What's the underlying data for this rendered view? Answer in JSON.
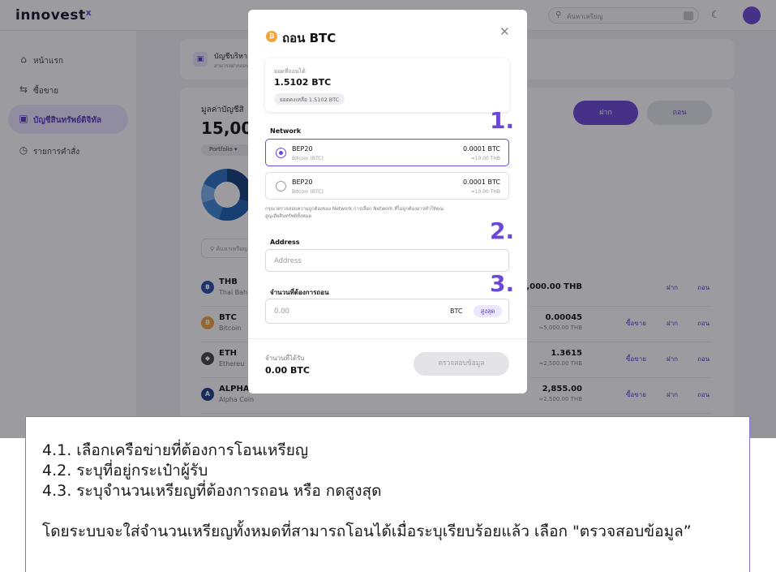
{
  "app": {
    "logo_text": "innovest",
    "logo_mark": "x",
    "search_placeholder": "ค้นหาเหรียญ",
    "icons": {
      "search": "search-icon",
      "theme": "moon-icon",
      "avatar": "avatar-icon"
    }
  },
  "sidebar": {
    "items": [
      {
        "label": "หน้าแรก",
        "icon": "home-icon",
        "symbol": "⌂"
      },
      {
        "label": "ซื้อขาย",
        "icon": "swap-icon",
        "symbol": "⇆"
      },
      {
        "label": "บัญชีสินทรัพย์ดิจิทัล",
        "icon": "wallet-icon",
        "symbol": "▣"
      },
      {
        "label": "รายการคำสั่ง",
        "icon": "clock-icon",
        "symbol": "◷"
      }
    ]
  },
  "account": {
    "title": "บัญชีบริหา",
    "subtitle": "สามารถฝากถอน"
  },
  "portfolio": {
    "value_label": "มูลค่าบัญชีสิ",
    "value": "15,00",
    "pill_label": "Portfolio",
    "search_placeholder": "ค้นหาเหรียญ",
    "deposit_label": "ฝาก",
    "withdraw_label": "ถอน"
  },
  "assets": [
    {
      "symbol": "THB",
      "name": "Thai Bah",
      "amount": "5,000.00 THB",
      "sub": "",
      "trade": "",
      "deposit": "ฝาก",
      "withdraw": "ถอน",
      "color": "#2c4aa3",
      "glyph": "฿"
    },
    {
      "symbol": "BTC",
      "name": "Bitcoin",
      "amount": "0.00045",
      "sub": "≈5,000.00 THB",
      "trade": "ซื้อขาย",
      "deposit": "ฝาก",
      "withdraw": "ถอน",
      "color": "#f2a33a",
      "glyph": "B"
    },
    {
      "symbol": "ETH",
      "name": "Ethereu",
      "amount": "1.3615",
      "sub": "≈2,500.00 THB",
      "trade": "ซื้อขาย",
      "deposit": "ฝาก",
      "withdraw": "ถอน",
      "color": "#444444",
      "glyph": "◆"
    },
    {
      "symbol": "ALPHA",
      "name": "Alpha Coin",
      "amount": "2,855.00",
      "sub": "≈2,500.00 THB",
      "trade": "ซื้อขาย",
      "deposit": "ฝาก",
      "withdraw": "ถอน",
      "color": "#1d3a8a",
      "glyph": "A"
    }
  ],
  "modal": {
    "title": "ถอน BTC",
    "close_icon": "close-icon",
    "balance_label": "ยอดที่ถอนได้",
    "balance_value": "1.5102 BTC",
    "remaining": "ยอดคงเหลือ 1.5102 BTC",
    "network_label": "Network",
    "networks": [
      {
        "name": "BEP20",
        "coin": "Bitcoin (BTC)",
        "fee": "0.0001 BTC",
        "fee_thb": "≈10.00 THB",
        "selected": true
      },
      {
        "name": "BEP20",
        "coin": "Bitcoin (BTC)",
        "fee": "0.0001 BTC",
        "fee_thb": "≈10.00 THB",
        "selected": false
      }
    ],
    "note_line1": "กรุณาตรวจสอบความถูกต้องของ Network การเลือก Network ที่ไม่ถูกต้องอาจทำให้คุณ",
    "note_line2": "สูญเสียสินทรัพย์ทั้งหมด",
    "address_label": "Address",
    "address_placeholder": "Address",
    "amount_label": "จำนวนที่ต้องการถอน",
    "amount_placeholder": "0.00",
    "amount_unit": "BTC",
    "max_label": "สูงสุด",
    "receive_label": "จำนวนที่ได้รับ",
    "receive_value": "0.00 BTC",
    "verify_label": "ตรวจสอบข้อมูล"
  },
  "steps": [
    "1.",
    "2.",
    "3."
  ],
  "instructions": {
    "line1": "4.1. เลือกเครือข่ายที่ต้องการโอนเหรียญ",
    "line2": "4.2. ระบุที่อยู่กระเป๋าผู้รับ",
    "line3": "4.3. ระบุจำนวนเหรียญที่ต้องการถอน หรือ กดสูงสุด",
    "line4": "โดยระบบจะใส่จำนวนเหรียญทั้งหมดที่สามารถโอนได้เมื่อระบุเรียบร้อยแล้ว เลือก \"ตรวจสอบข้อมูล”"
  },
  "colors": {
    "accent": "#6c48d6",
    "btc": "#f2a33a",
    "overlay": "rgba(20,20,28,0.42)"
  }
}
